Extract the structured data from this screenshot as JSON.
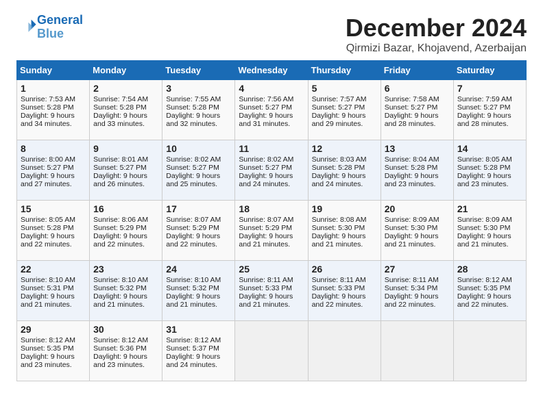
{
  "logo": {
    "line1": "General",
    "line2": "Blue"
  },
  "title": "December 2024",
  "location": "Qirmizi Bazar, Khojavend, Azerbaijan",
  "days_of_week": [
    "Sunday",
    "Monday",
    "Tuesday",
    "Wednesday",
    "Thursday",
    "Friday",
    "Saturday"
  ],
  "weeks": [
    [
      {
        "day": 1,
        "sunrise": "7:53 AM",
        "sunset": "5:28 PM",
        "daylight": "9 hours and 34 minutes."
      },
      {
        "day": 2,
        "sunrise": "7:54 AM",
        "sunset": "5:28 PM",
        "daylight": "9 hours and 33 minutes."
      },
      {
        "day": 3,
        "sunrise": "7:55 AM",
        "sunset": "5:28 PM",
        "daylight": "9 hours and 32 minutes."
      },
      {
        "day": 4,
        "sunrise": "7:56 AM",
        "sunset": "5:27 PM",
        "daylight": "9 hours and 31 minutes."
      },
      {
        "day": 5,
        "sunrise": "7:57 AM",
        "sunset": "5:27 PM",
        "daylight": "9 hours and 29 minutes."
      },
      {
        "day": 6,
        "sunrise": "7:58 AM",
        "sunset": "5:27 PM",
        "daylight": "9 hours and 28 minutes."
      },
      {
        "day": 7,
        "sunrise": "7:59 AM",
        "sunset": "5:27 PM",
        "daylight": "9 hours and 28 minutes."
      }
    ],
    [
      {
        "day": 8,
        "sunrise": "8:00 AM",
        "sunset": "5:27 PM",
        "daylight": "9 hours and 27 minutes."
      },
      {
        "day": 9,
        "sunrise": "8:01 AM",
        "sunset": "5:27 PM",
        "daylight": "9 hours and 26 minutes."
      },
      {
        "day": 10,
        "sunrise": "8:02 AM",
        "sunset": "5:27 PM",
        "daylight": "9 hours and 25 minutes."
      },
      {
        "day": 11,
        "sunrise": "8:02 AM",
        "sunset": "5:27 PM",
        "daylight": "9 hours and 24 minutes."
      },
      {
        "day": 12,
        "sunrise": "8:03 AM",
        "sunset": "5:28 PM",
        "daylight": "9 hours and 24 minutes."
      },
      {
        "day": 13,
        "sunrise": "8:04 AM",
        "sunset": "5:28 PM",
        "daylight": "9 hours and 23 minutes."
      },
      {
        "day": 14,
        "sunrise": "8:05 AM",
        "sunset": "5:28 PM",
        "daylight": "9 hours and 23 minutes."
      }
    ],
    [
      {
        "day": 15,
        "sunrise": "8:05 AM",
        "sunset": "5:28 PM",
        "daylight": "9 hours and 22 minutes."
      },
      {
        "day": 16,
        "sunrise": "8:06 AM",
        "sunset": "5:29 PM",
        "daylight": "9 hours and 22 minutes."
      },
      {
        "day": 17,
        "sunrise": "8:07 AM",
        "sunset": "5:29 PM",
        "daylight": "9 hours and 22 minutes."
      },
      {
        "day": 18,
        "sunrise": "8:07 AM",
        "sunset": "5:29 PM",
        "daylight": "9 hours and 21 minutes."
      },
      {
        "day": 19,
        "sunrise": "8:08 AM",
        "sunset": "5:30 PM",
        "daylight": "9 hours and 21 minutes."
      },
      {
        "day": 20,
        "sunrise": "8:09 AM",
        "sunset": "5:30 PM",
        "daylight": "9 hours and 21 minutes."
      },
      {
        "day": 21,
        "sunrise": "8:09 AM",
        "sunset": "5:30 PM",
        "daylight": "9 hours and 21 minutes."
      }
    ],
    [
      {
        "day": 22,
        "sunrise": "8:10 AM",
        "sunset": "5:31 PM",
        "daylight": "9 hours and 21 minutes."
      },
      {
        "day": 23,
        "sunrise": "8:10 AM",
        "sunset": "5:32 PM",
        "daylight": "9 hours and 21 minutes."
      },
      {
        "day": 24,
        "sunrise": "8:10 AM",
        "sunset": "5:32 PM",
        "daylight": "9 hours and 21 minutes."
      },
      {
        "day": 25,
        "sunrise": "8:11 AM",
        "sunset": "5:33 PM",
        "daylight": "9 hours and 21 minutes."
      },
      {
        "day": 26,
        "sunrise": "8:11 AM",
        "sunset": "5:33 PM",
        "daylight": "9 hours and 22 minutes."
      },
      {
        "day": 27,
        "sunrise": "8:11 AM",
        "sunset": "5:34 PM",
        "daylight": "9 hours and 22 minutes."
      },
      {
        "day": 28,
        "sunrise": "8:12 AM",
        "sunset": "5:35 PM",
        "daylight": "9 hours and 22 minutes."
      }
    ],
    [
      {
        "day": 29,
        "sunrise": "8:12 AM",
        "sunset": "5:35 PM",
        "daylight": "9 hours and 23 minutes."
      },
      {
        "day": 30,
        "sunrise": "8:12 AM",
        "sunset": "5:36 PM",
        "daylight": "9 hours and 23 minutes."
      },
      {
        "day": 31,
        "sunrise": "8:12 AM",
        "sunset": "5:37 PM",
        "daylight": "9 hours and 24 minutes."
      },
      null,
      null,
      null,
      null
    ]
  ]
}
